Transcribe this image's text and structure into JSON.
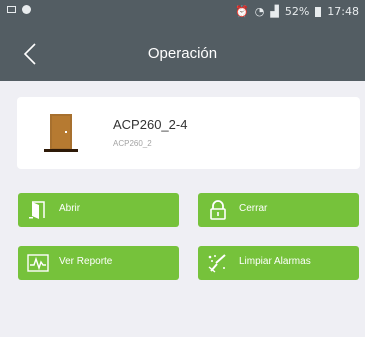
{
  "status_bar": {
    "battery": "52%",
    "time": "17:48"
  },
  "header": {
    "title": "Operación"
  },
  "device": {
    "name": "ACP260_2-4",
    "subtitle": "ACP260_2"
  },
  "actions": [
    {
      "label": "Abrir",
      "icon": "door-open-icon"
    },
    {
      "label": "Cerrar",
      "icon": "lock-icon"
    },
    {
      "label": "Ver Reporte",
      "icon": "report-chart-icon"
    },
    {
      "label": "Limpiar Alarmas",
      "icon": "clear-broom-icon"
    }
  ],
  "colors": {
    "header_bg": "#535d63",
    "button_green": "#76c23b",
    "background": "#efeff4",
    "door_brown": "#a7702e"
  }
}
